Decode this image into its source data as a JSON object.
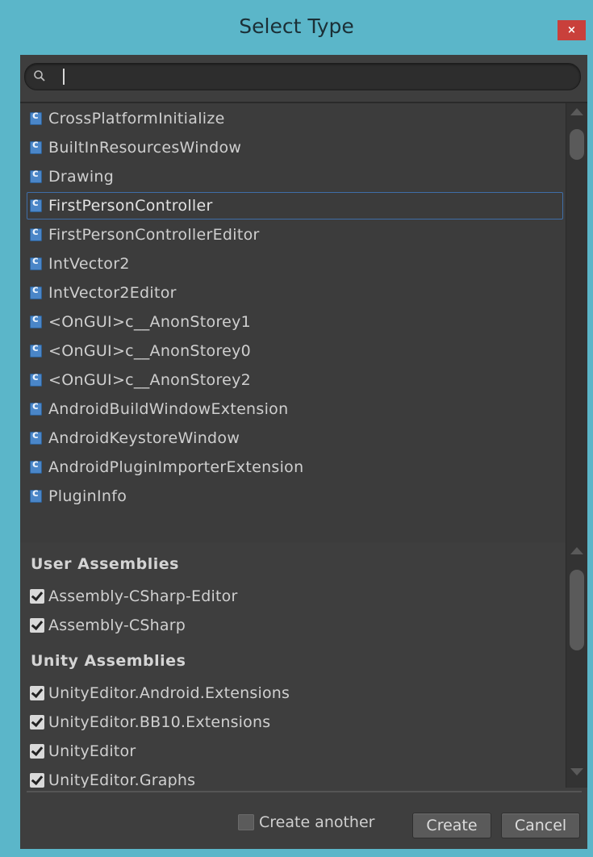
{
  "window": {
    "title": "Select Type",
    "close_symbol": "×"
  },
  "search": {
    "value": "",
    "icon": "search-icon"
  },
  "types": [
    {
      "label": "CrossPlatformInitialize",
      "icon": "csharp-script-icon",
      "selected": false
    },
    {
      "label": "BuiltInResourcesWindow",
      "icon": "csharp-script-icon",
      "selected": false
    },
    {
      "label": "Drawing",
      "icon": "csharp-script-icon",
      "selected": false
    },
    {
      "label": "FirstPersonController",
      "icon": "csharp-script-icon",
      "selected": true
    },
    {
      "label": "FirstPersonControllerEditor",
      "icon": "csharp-script-icon",
      "selected": false
    },
    {
      "label": "IntVector2",
      "icon": "csharp-script-icon",
      "selected": false
    },
    {
      "label": "IntVector2Editor",
      "icon": "csharp-script-icon",
      "selected": false
    },
    {
      "label": "<OnGUI>c__AnonStorey1",
      "icon": "csharp-script-icon",
      "selected": false
    },
    {
      "label": "<OnGUI>c__AnonStorey0",
      "icon": "csharp-script-icon",
      "selected": false
    },
    {
      "label": "<OnGUI>c__AnonStorey2",
      "icon": "csharp-script-icon",
      "selected": false
    },
    {
      "label": "AndroidBuildWindowExtension",
      "icon": "csharp-script-icon",
      "selected": false
    },
    {
      "label": "AndroidKeystoreWindow",
      "icon": "csharp-script-icon",
      "selected": false
    },
    {
      "label": "AndroidPluginImporterExtension",
      "icon": "csharp-script-icon",
      "selected": false
    },
    {
      "label": "PluginInfo",
      "icon": "csharp-script-icon",
      "selected": false
    }
  ],
  "assemblies": {
    "user_header": "User Assemblies",
    "user": [
      {
        "label": "Assembly-CSharp-Editor",
        "checked": true
      },
      {
        "label": "Assembly-CSharp",
        "checked": true
      }
    ],
    "unity_header": "Unity Assemblies",
    "unity": [
      {
        "label": "UnityEditor.Android.Extensions",
        "checked": true
      },
      {
        "label": "UnityEditor.BB10.Extensions",
        "checked": true
      },
      {
        "label": "UnityEditor",
        "checked": true
      },
      {
        "label": "UnityEditor.Graphs",
        "checked": true
      }
    ]
  },
  "footer": {
    "create_another_label": "Create another",
    "create_another_checked": false,
    "create_label": "Create",
    "cancel_label": "Cancel"
  },
  "colors": {
    "window_frame": "#5bb6c9",
    "close_button": "#c9403b",
    "panel_background": "#3e3e3e",
    "selection_border": "#3f6ea8",
    "script_icon": "#4a86c8"
  }
}
